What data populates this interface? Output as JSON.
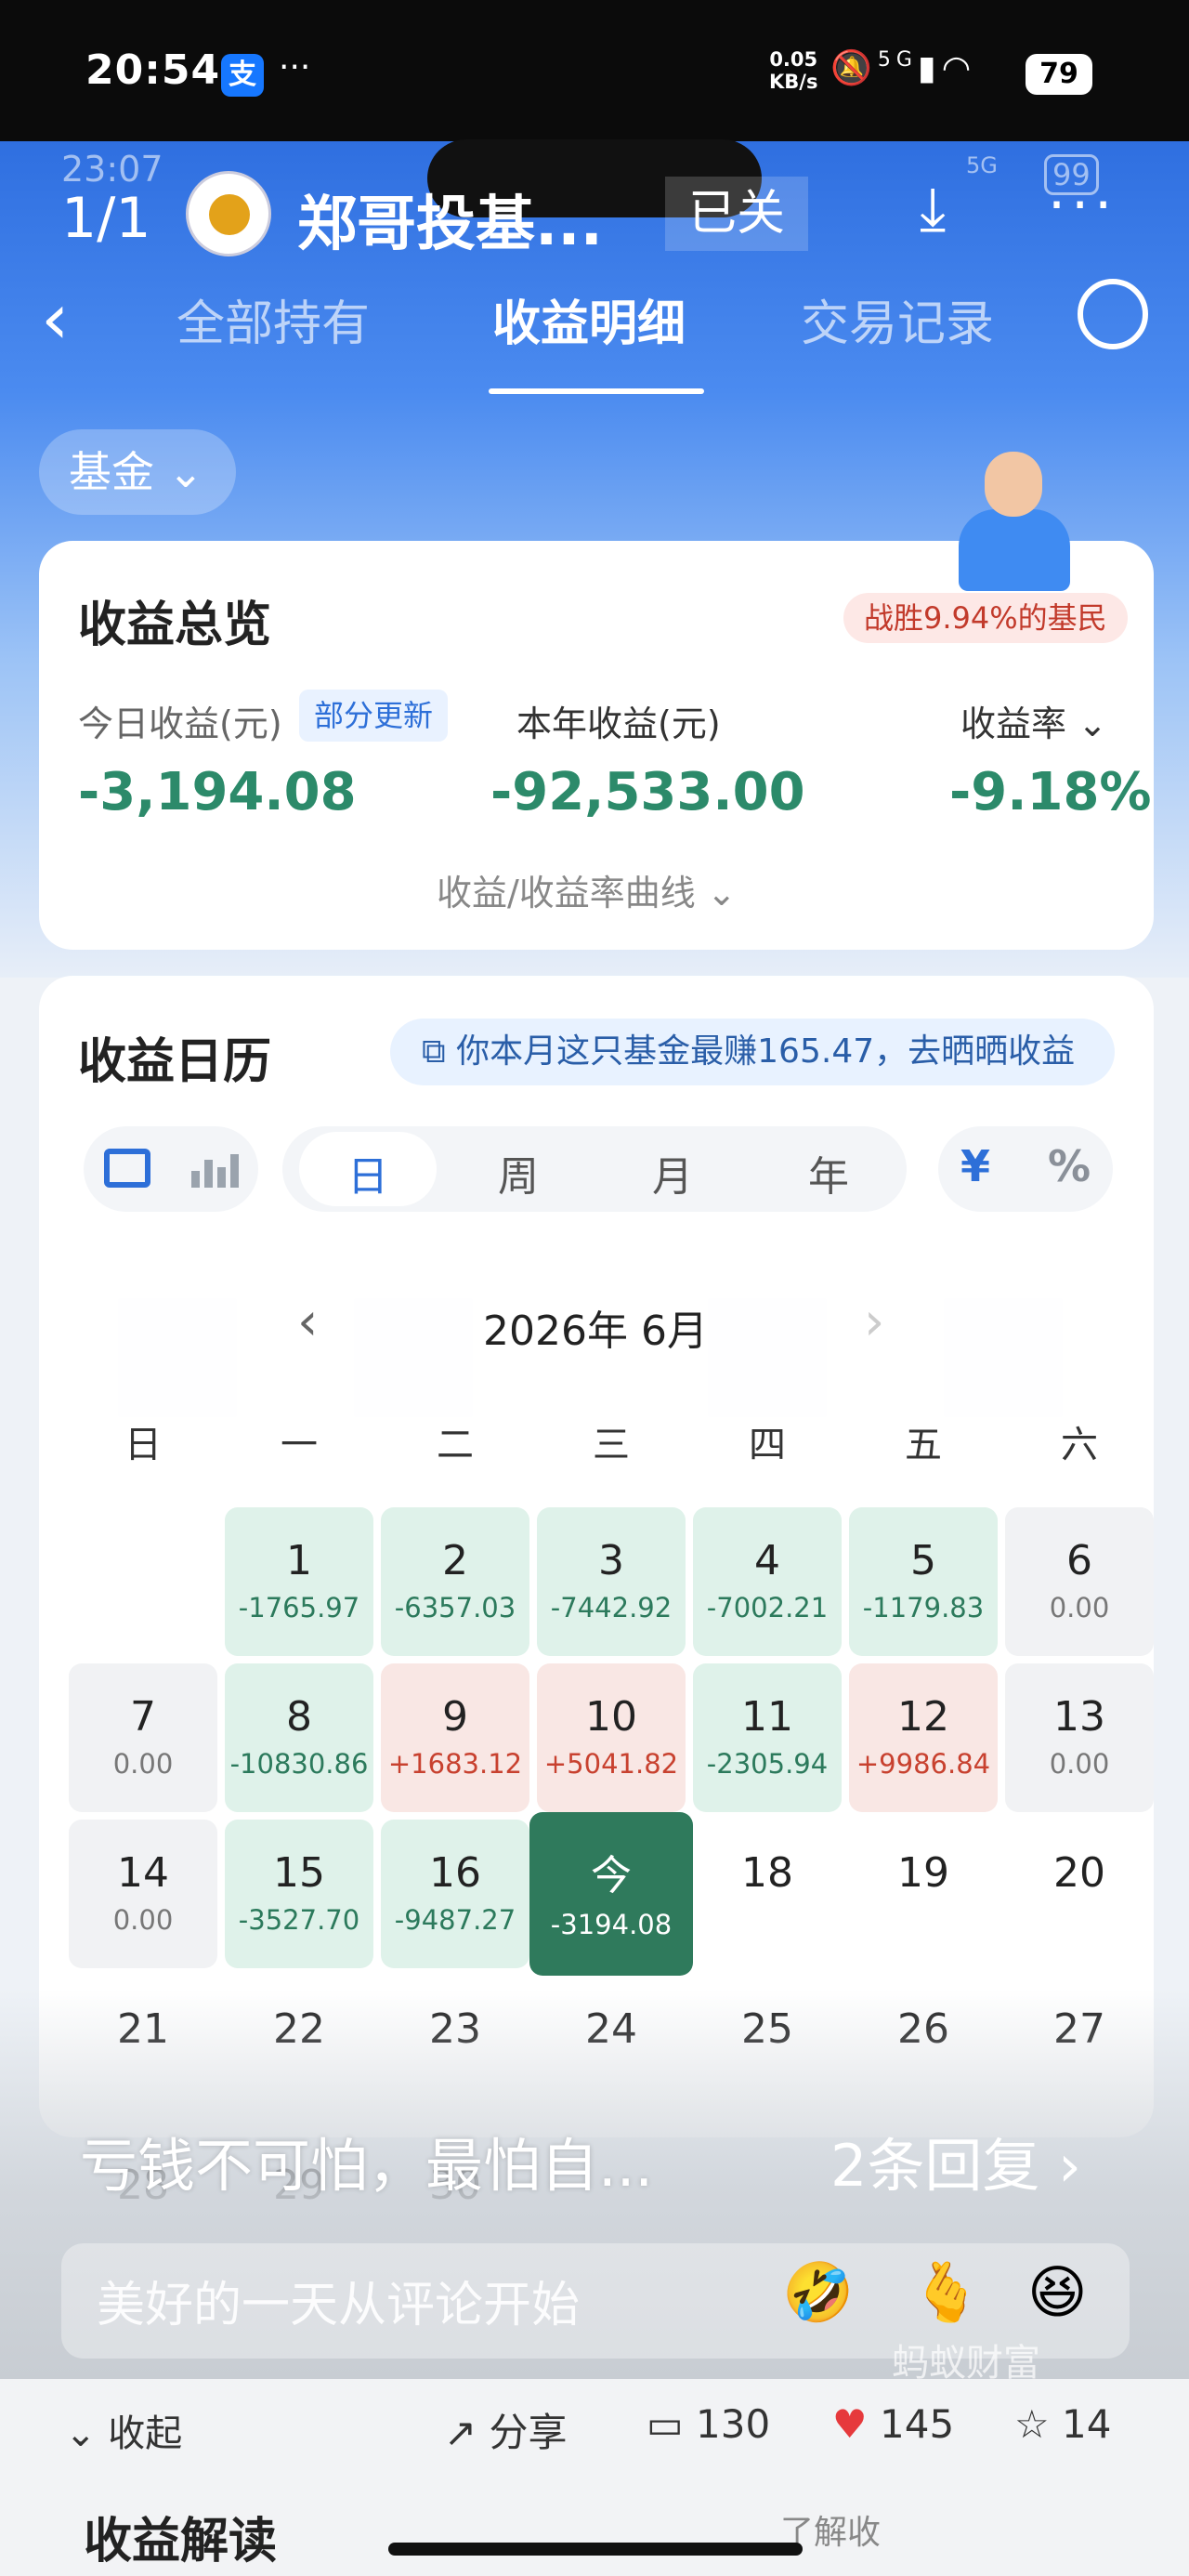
{
  "status_bar": {
    "time": "20:54",
    "net_speed_value": "0.05",
    "net_speed_unit": "KB/s",
    "network": "5G",
    "battery": "79",
    "more": "···"
  },
  "inner_status": {
    "time": "23:07",
    "network": "5G",
    "battery": "99"
  },
  "header": {
    "page_count": "1/1",
    "profile_name": "郑哥投基...",
    "closed_label": "已关",
    "more": "···"
  },
  "tabs": [
    "全部持有",
    "收益明细",
    "交易记录"
  ],
  "fund_filter": "基金 ⌄",
  "overview": {
    "title": "收益总览",
    "beat_badge": "战胜9.94%的基民",
    "today_label": "今日收益(元)",
    "partial_update": "部分更新",
    "today_value": "-3,194.08",
    "year_label": "本年收益(元)",
    "year_value": "-92,533.00",
    "rate_label": "收益率 ⌄",
    "rate_value": "-9.18%",
    "curve_link": "收益/收益率曲线 ⌄"
  },
  "calendar": {
    "title": "收益日历",
    "promo": "你本月这只基金最赚165.47，去晒晒收益",
    "periods": [
      "日",
      "周",
      "月",
      "年"
    ],
    "units": [
      "¥",
      "%"
    ],
    "month": "2026年 6月",
    "weekdays": [
      "日",
      "一",
      "二",
      "三",
      "四",
      "五",
      "六"
    ],
    "days": [
      {
        "d": "1",
        "v": "-1765.97"
      },
      {
        "d": "2",
        "v": "-6357.03"
      },
      {
        "d": "3",
        "v": "-7442.92"
      },
      {
        "d": "4",
        "v": "-7002.21"
      },
      {
        "d": "5",
        "v": "-1179.83"
      },
      {
        "d": "6",
        "v": "0.00"
      },
      {
        "d": "7",
        "v": "0.00"
      },
      {
        "d": "8",
        "v": "-10830.86"
      },
      {
        "d": "9",
        "v": "+1683.12"
      },
      {
        "d": "10",
        "v": "+5041.82"
      },
      {
        "d": "11",
        "v": "-2305.94"
      },
      {
        "d": "12",
        "v": "+9986.84"
      },
      {
        "d": "13",
        "v": "0.00"
      },
      {
        "d": "14",
        "v": "0.00"
      },
      {
        "d": "15",
        "v": "-3527.70"
      },
      {
        "d": "16",
        "v": "-9487.27"
      },
      {
        "d": "今",
        "v": "-3194.08"
      },
      {
        "d": "18",
        "v": ""
      },
      {
        "d": "19",
        "v": ""
      },
      {
        "d": "20",
        "v": ""
      },
      {
        "d": "21",
        "v": ""
      },
      {
        "d": "22",
        "v": ""
      },
      {
        "d": "23",
        "v": ""
      },
      {
        "d": "24",
        "v": ""
      },
      {
        "d": "25",
        "v": ""
      },
      {
        "d": "26",
        "v": ""
      },
      {
        "d": "27",
        "v": ""
      },
      {
        "d": "28",
        "v": ""
      },
      {
        "d": "29",
        "v": ""
      },
      {
        "d": "30",
        "v": ""
      }
    ]
  },
  "comment": {
    "top_comment": "亏钱不可怕，最怕自...",
    "replies": "2条回复 ›",
    "placeholder": "美好的一天从评论开始",
    "emojis": [
      "🤣",
      "🫰",
      "😆"
    ],
    "watermark": "蚂蚁财富"
  },
  "bottom": {
    "collapse": "收起",
    "share": "分享",
    "comments": "130",
    "likes": "145",
    "favorites": "14",
    "section": "收益解读",
    "learn_more": "了解收"
  }
}
